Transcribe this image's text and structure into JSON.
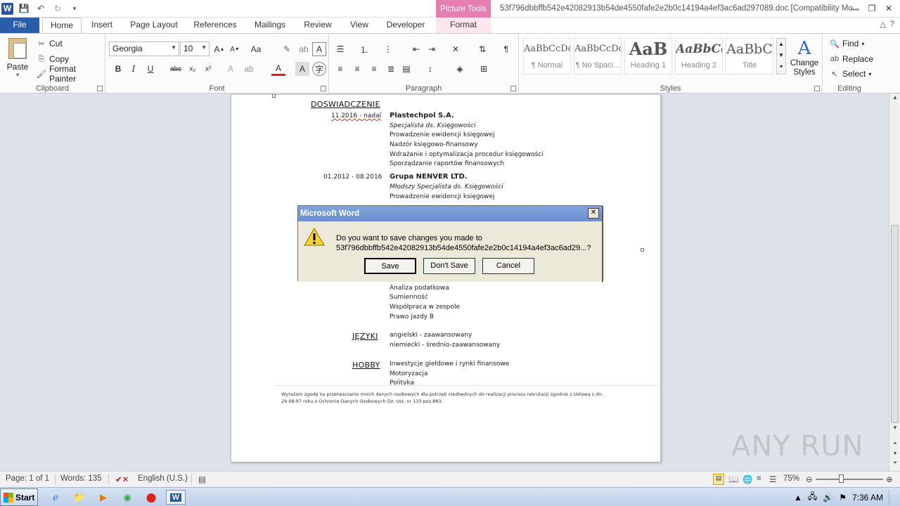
{
  "window": {
    "title": "53f796dbbffb542e42082913b54de4550fafe2e2b0c14194a4ef3ac6ad297089.doc [Compatibility Mo...",
    "contextual_tab_group": "Picture Tools"
  },
  "tabs": [
    {
      "label": "File"
    },
    {
      "label": "Home"
    },
    {
      "label": "Insert"
    },
    {
      "label": "Page Layout"
    },
    {
      "label": "References"
    },
    {
      "label": "Mailings"
    },
    {
      "label": "Review"
    },
    {
      "label": "View"
    },
    {
      "label": "Developer"
    },
    {
      "label": "Format"
    }
  ],
  "ribbon": {
    "clipboard": {
      "label": "Clipboard",
      "paste": "Paste",
      "cut": "Cut",
      "copy": "Copy",
      "format_painter": "Format Painter"
    },
    "font": {
      "label": "Font",
      "family": "Georgia",
      "size": "10"
    },
    "paragraph": {
      "label": "Paragraph"
    },
    "styles": {
      "label": "Styles",
      "items": [
        {
          "sample": "AaBbCcDc",
          "name": "¶ Normal"
        },
        {
          "sample": "AaBbCcDc",
          "name": "¶ No Spaci..."
        },
        {
          "sample": "AaB",
          "name": "Heading 1"
        },
        {
          "sample": "AaBbCc",
          "name": "Heading 2"
        },
        {
          "sample": "AaBbC",
          "name": "Title"
        }
      ],
      "change_styles": "Change Styles"
    },
    "editing": {
      "label": "Editing",
      "find": "Find",
      "replace": "Replace",
      "select": "Select"
    }
  },
  "document": {
    "section_experience": "DOSWIADCZENIE",
    "job1": {
      "dates": "11.2016 - nadal",
      "company": "Plastechpol S.A.",
      "role": "Specjalista ds. Księgowości",
      "duties": [
        "Prowadzenie ewidencji księgowej",
        "Nadzór księgowo-finansowy",
        "Wdrażanie i optymalizacja procedur księgowości",
        "Sporządzanie raportów finansowych"
      ]
    },
    "job2": {
      "dates": "01.2012 - 08.2016",
      "company": "Grupa NENVER LTD.",
      "role": "Młodszy Specjalista ds. Księgowości",
      "duties": [
        "Prowadzenie ewidencji księgowej"
      ]
    },
    "skills": [
      "Analiza podatkowa",
      "Sumienność",
      "Współpraca w zespole",
      "Prawo jazdy B"
    ],
    "section_languages": "JĘZYKI",
    "languages": [
      "angielski - zaawansowany",
      "niemiecki - średnio-zaawansowany"
    ],
    "section_hobby": "HOBBY",
    "hobbies": [
      "Inwestycje giełdowe i rynki finansowe",
      "Motoryzacja",
      "Polityka"
    ],
    "consent_line1": "Wyrażam zgodę na przetwarzanie moich danych osobowych dla potrzeb niezbędnych do realizacji procesu rekrutacji zgodnie z Ustawą z dn.",
    "consent_line2": "29.08.97 roku o Ochronie Danych Osobowych Dz. Ust. nr 133 poz.883."
  },
  "dialog": {
    "title": "Microsoft Word",
    "message_line1": "Do you want to save changes you made to",
    "message_line2": "53f796dbbffb542e42082913b54de4550fafe2e2b0c14194a4ef3ac6ad29...?",
    "save": "Save",
    "dont_save": "Don't Save",
    "cancel": "Cancel"
  },
  "status": {
    "page": "Page: 1 of 1",
    "words": "Words: 135",
    "language": "English (U.S.)",
    "zoom": "75%"
  },
  "taskbar": {
    "start": "Start",
    "time": "7:36 AM"
  },
  "watermark": "ANY RUN",
  "colors": {
    "file_tab": "#2a5caa",
    "picture_tools": "#e57fb1",
    "dialog_title": "#7fa3d9",
    "spell_error": "#e0302b"
  }
}
